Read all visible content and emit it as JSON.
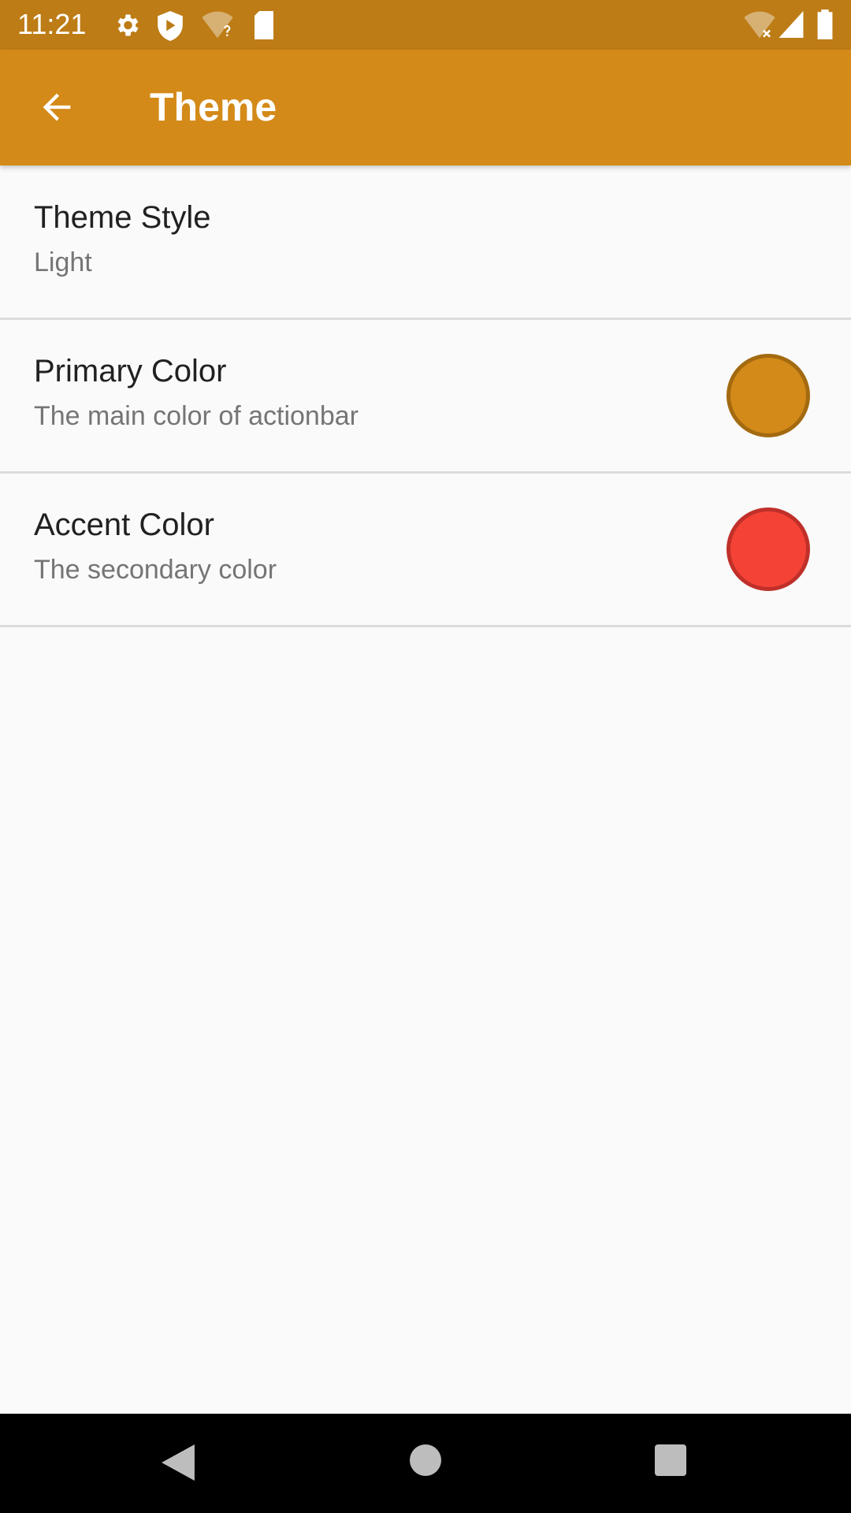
{
  "status_bar": {
    "time": "11:21",
    "icons": [
      "settings-icon",
      "shield-play-icon",
      "wifi-unknown-icon",
      "sd-card-icon",
      "wifi-off-icon",
      "signal-icon",
      "battery-icon"
    ]
  },
  "toolbar": {
    "title": "Theme",
    "back_icon": "arrow-left-icon"
  },
  "settings": [
    {
      "title": "Theme Style",
      "summary": "Light"
    },
    {
      "title": "Primary Color",
      "summary": "The main color of actionbar",
      "color": "#d48a19",
      "border": "#a36a10"
    },
    {
      "title": "Accent Color",
      "summary": "The secondary color",
      "color": "#f44336",
      "border": "#c0302a"
    }
  ],
  "nav_bar": {
    "icons": [
      "back-triangle-icon",
      "home-circle-icon",
      "recents-square-icon"
    ]
  }
}
